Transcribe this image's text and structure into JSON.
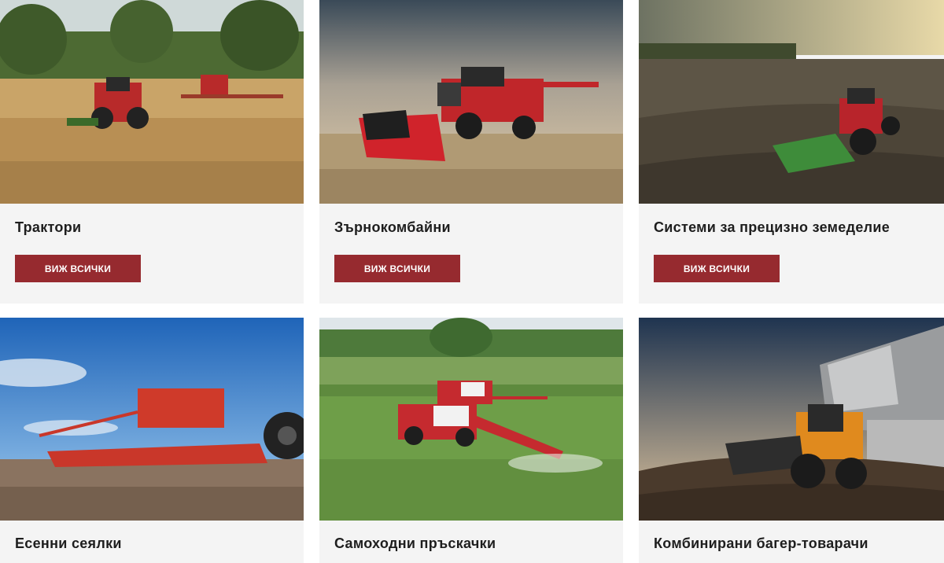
{
  "cards": [
    {
      "title": "Трактори",
      "button_label": "ВИЖ ВСИЧКИ"
    },
    {
      "title": "Зърнокомбайни",
      "button_label": "ВИЖ ВСИЧКИ"
    },
    {
      "title": "Системи за прецизно земеделие",
      "button_label": "ВИЖ ВСИЧКИ"
    },
    {
      "title": "Есенни сеялки"
    },
    {
      "title": "Самоходни пръскачки"
    },
    {
      "title": "Комбинирани багер-товарачи"
    }
  ],
  "colors": {
    "button_bg": "#962a2f",
    "card_bg": "#f4f4f4",
    "title_text": "#1e1e1e"
  }
}
